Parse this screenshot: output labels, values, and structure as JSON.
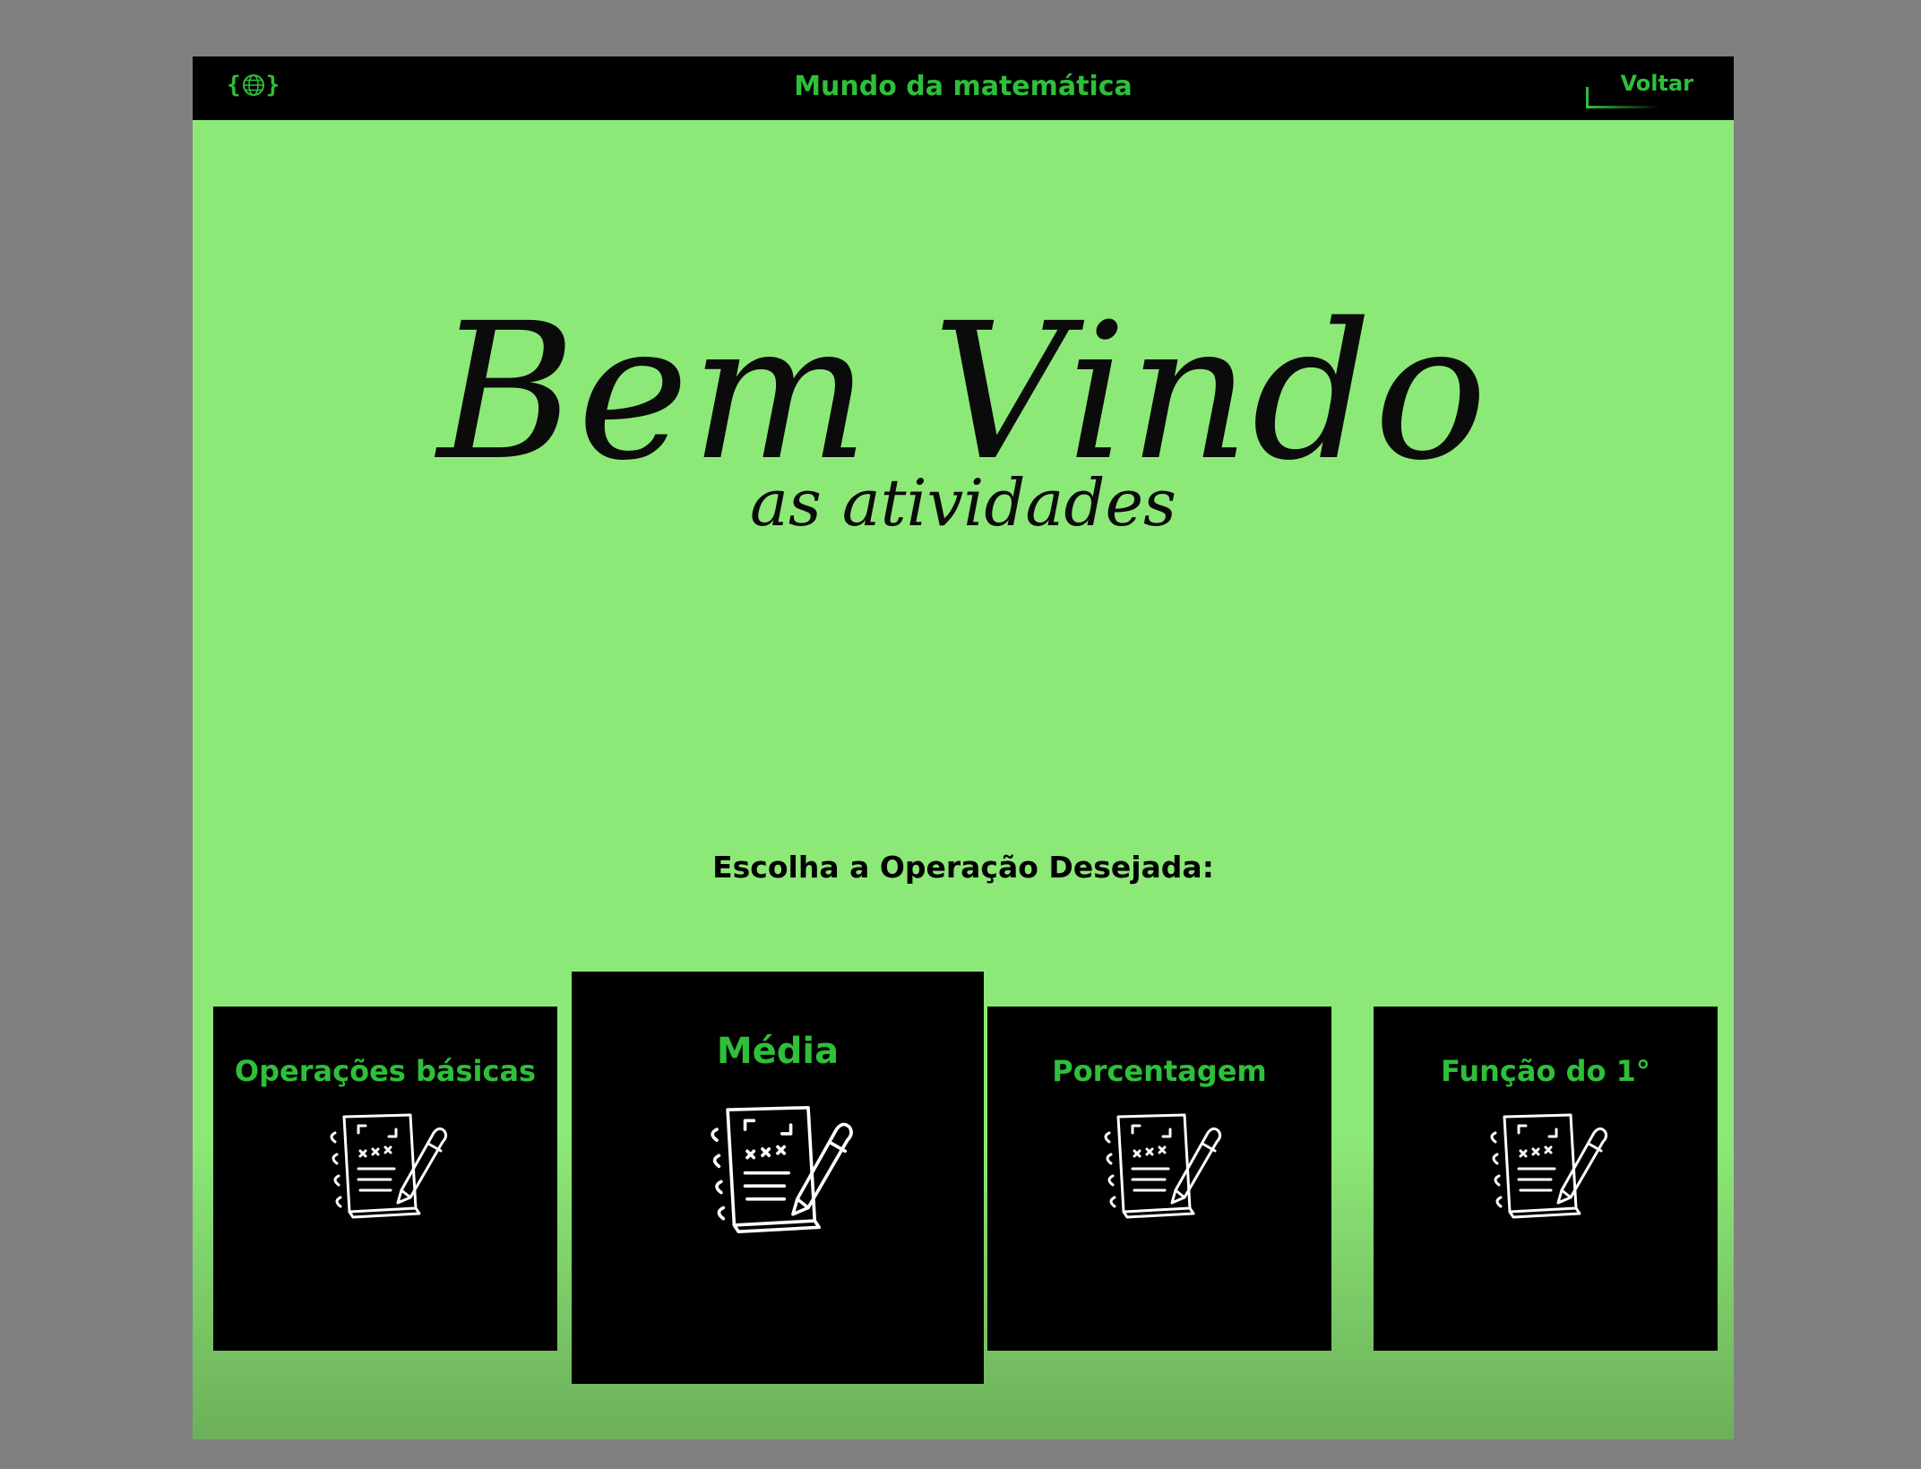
{
  "header": {
    "logo_left_brace": "{",
    "logo_right_brace": "}",
    "logo_icon": "globe-icon",
    "title": "Mundo da matemática",
    "back_label": "Voltar"
  },
  "hero": {
    "title": "Bem Vindo",
    "subtitle": "as atividades"
  },
  "prompt": "Escolha a Operação Desejada:",
  "cards": [
    {
      "label": "Operações básicas",
      "icon": "notebook-pencil-icon"
    },
    {
      "label": "Média",
      "icon": "notebook-pencil-icon"
    },
    {
      "label": "Porcentagem",
      "icon": "notebook-pencil-icon"
    },
    {
      "label": "Função do 1°",
      "icon": "notebook-pencil-icon"
    }
  ],
  "colors": {
    "background_outer": "#808080",
    "page_green": "#8de977",
    "accent_green": "#2fbf3a",
    "bar_black": "#000000"
  }
}
